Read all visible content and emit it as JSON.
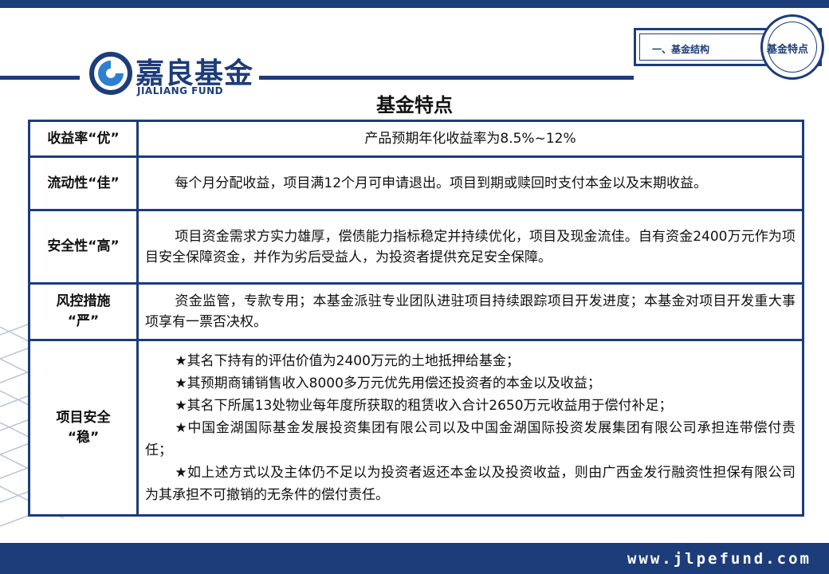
{
  "header": {
    "logo_cn": "嘉良基金",
    "logo_en": "JIALIANG FUND",
    "nav_section": "一、基金结构",
    "nav_current": "基金特点"
  },
  "page_title": "基金特点",
  "rows": [
    {
      "label": "收益率“优”",
      "text": "产品预期年化收益率为8.5%~12%"
    },
    {
      "label": "流动性“佳”",
      "text": "每个月分配收益，项目满12个月可申请退出。项目到期或赎回时支付本金以及末期收益。"
    },
    {
      "label": "安全性“高”",
      "text": "项目资金需求方实力雄厚，偿债能力指标稳定并持续优化，项目及现金流佳。自有资金2400万元作为项目安全保障资金，并作为劣后受益人，为投资者提供充足安全保障。"
    },
    {
      "label_line1": "风控措施",
      "label_line2": "“严”",
      "text": "资金监管，专款专用；本基金派驻专业团队进驻项目持续跟踪项目开发进度；本基金对项目开发重大事项享有一票否决权。"
    },
    {
      "label_line1": "项目安全",
      "label_line2": "“稳”",
      "items": [
        "★其名下持有的评估价值为2400万元的土地抵押给基金；",
        "★其预期商铺销售收入8000多万元优先用偿还投资者的本金以及收益；",
        "★其名下所属13处物业每年度所获取的租赁收入合计2650万元收益用于偿付补足；",
        "★中国金湖国际基金发展投资集团有限公司以及中国金湖国际投资发展集团有限公司承担连带偿付责任；",
        "★如上述方式以及主体仍不足以为投资者返还本金以及投资收益，则由广西金发行融资性担保有限公司为其承担不可撤销的无条件的偿付责任。"
      ]
    }
  ],
  "footer": {
    "url": "www.jlpefund.com"
  }
}
